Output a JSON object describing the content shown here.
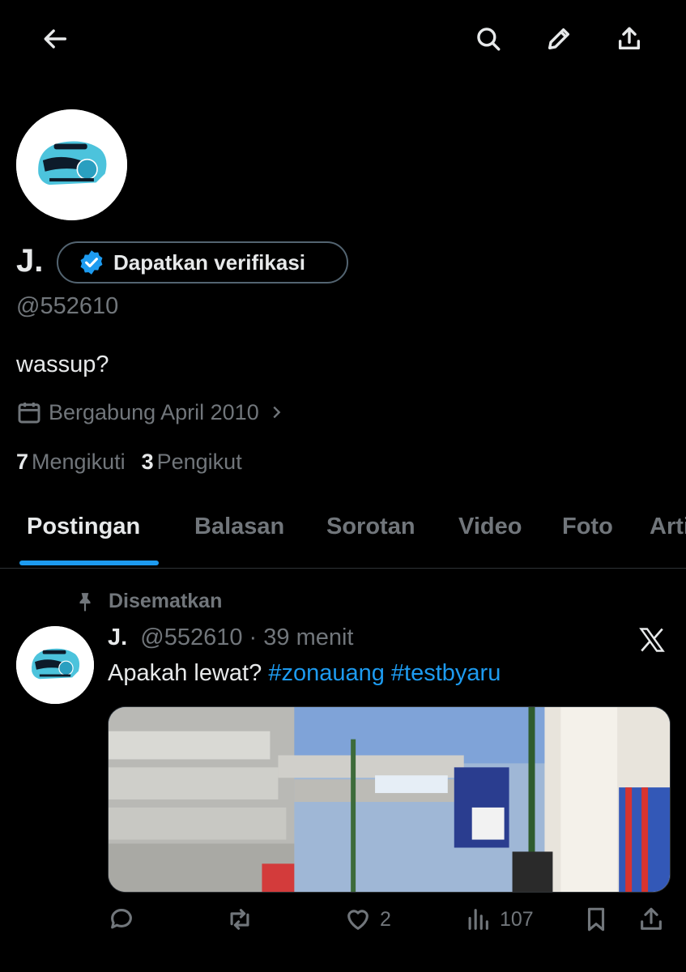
{
  "profile": {
    "name": "J.",
    "verify_label": "Dapatkan verifikasi",
    "handle": "@552610",
    "bio": "wassup?",
    "joined": "Bergabung April 2010",
    "following_count": "7",
    "following_label": "Mengikuti",
    "followers_count": "3",
    "followers_label": "Pengikut"
  },
  "icons": {
    "back": "arrow-left-icon",
    "search": "search-icon",
    "edit": "pencil-icon",
    "share": "share-icon"
  },
  "tabs": [
    {
      "label": "Postingan",
      "active": true
    },
    {
      "label": "Balasan"
    },
    {
      "label": "Sorotan"
    },
    {
      "label": "Video"
    },
    {
      "label": "Foto"
    },
    {
      "label": "Artikel"
    }
  ],
  "post": {
    "pinned_label": "Disematkan",
    "author": "J.",
    "handle": "@552610",
    "separator": "·",
    "time": "39 menit",
    "text": "Apakah lewat?",
    "hashtags": [
      "#zonauang",
      "#testbyaru"
    ],
    "likes": "2",
    "views": "107"
  },
  "colors": {
    "background": "#000000",
    "text": "#e7e9ea",
    "muted": "#71767b",
    "accent": "#1d9bf0",
    "border": "#2f3336"
  }
}
